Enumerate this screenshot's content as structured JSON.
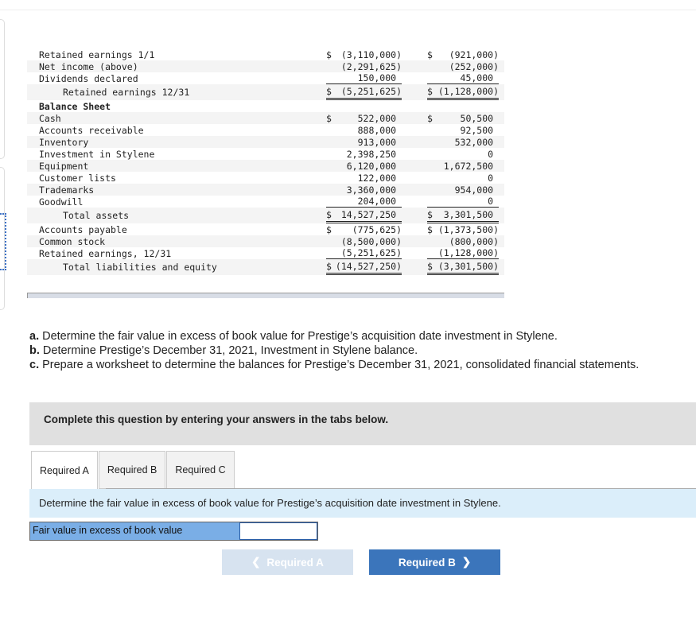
{
  "financials": {
    "rows": [
      {
        "label": "Retained earnings 1/1",
        "c1s": "$",
        "c1": "(3,110,000)",
        "c2s": "$",
        "c2": "(921,000)"
      },
      {
        "label": "Net income (above)",
        "c1s": "",
        "c1": "(2,291,625)",
        "c2s": "",
        "c2": "(252,000)"
      },
      {
        "label": "Dividends declared",
        "c1s": "",
        "c1": "150,000 ",
        "c2s": "",
        "c2": "45,000 "
      },
      {
        "label": "Retained earnings 12/31",
        "c1s": "$",
        "c1": "(5,251,625)",
        "c2s": "$",
        "c2": "(1,128,000)"
      },
      {
        "label": "Balance Sheet",
        "c1s": "",
        "c1": "",
        "c2s": "",
        "c2": ""
      },
      {
        "label": "Cash",
        "c1s": "$",
        "c1": "522,000 ",
        "c2s": "$",
        "c2": "50,500 "
      },
      {
        "label": "Accounts receivable",
        "c1s": "",
        "c1": "888,000 ",
        "c2s": "",
        "c2": "92,500 "
      },
      {
        "label": "Inventory",
        "c1s": "",
        "c1": "913,000 ",
        "c2s": "",
        "c2": "532,000 "
      },
      {
        "label": "Investment in Stylene",
        "c1s": "",
        "c1": "2,398,250 ",
        "c2s": "",
        "c2": "0 "
      },
      {
        "label": "Equipment",
        "c1s": "",
        "c1": "6,120,000 ",
        "c2s": "",
        "c2": "1,672,500 "
      },
      {
        "label": "Customer lists",
        "c1s": "",
        "c1": "122,000 ",
        "c2s": "",
        "c2": "0 "
      },
      {
        "label": "Trademarks",
        "c1s": "",
        "c1": "3,360,000 ",
        "c2s": "",
        "c2": "954,000 "
      },
      {
        "label": "Goodwill",
        "c1s": "",
        "c1": "204,000 ",
        "c2s": "",
        "c2": "0 "
      },
      {
        "label": "Total assets",
        "c1s": "$",
        "c1": "14,527,250 ",
        "c2s": "$",
        "c2": "3,301,500 "
      },
      {
        "label": "Accounts payable",
        "c1s": "$",
        "c1": "(775,625)",
        "c2s": "$",
        "c2": "(1,373,500)"
      },
      {
        "label": "Common stock",
        "c1s": "",
        "c1": "(8,500,000)",
        "c2s": "",
        "c2": "(800,000)"
      },
      {
        "label": "Retained earnings, 12/31",
        "c1s": "",
        "c1": "(5,251,625)",
        "c2s": "",
        "c2": "(1,128,000)"
      },
      {
        "label": "Total liabilities and equity",
        "c1s": "$",
        "c1": "(14,527,250)",
        "c2s": "$",
        "c2": "(3,301,500)"
      }
    ]
  },
  "questions": [
    {
      "letter": "a.",
      "text": " Determine the fair value in excess of book value for Prestige’s acquisition date investment in Stylene."
    },
    {
      "letter": "b.",
      "text": " Determine Prestige’s December 31, 2021, Investment in Stylene balance."
    },
    {
      "letter": "c.",
      "text": " Prepare a worksheet to determine the balances for Prestige’s December 31, 2021, consolidated financial statements."
    }
  ],
  "banner": "Complete this question by entering your answers in the tabs below.",
  "tabs": [
    "Required A",
    "Required B",
    "Required C"
  ],
  "active_tab": "Required A",
  "instruction": "Determine the fair value in excess of book value for Prestige’s acquisition date investment in Stylene.",
  "field": {
    "label": "Fair value in excess of book value",
    "value": ""
  },
  "nav": {
    "prev": "Required A",
    "next": "Required B",
    "prev_icon": "chevron-left-icon",
    "next_icon": "chevron-right-icon"
  },
  "colors": {
    "accent": "#3b75bb",
    "field_label": "#7aaee6",
    "instruction_bg": "#dbeefa",
    "banner_bg": "#e0e0e0"
  }
}
